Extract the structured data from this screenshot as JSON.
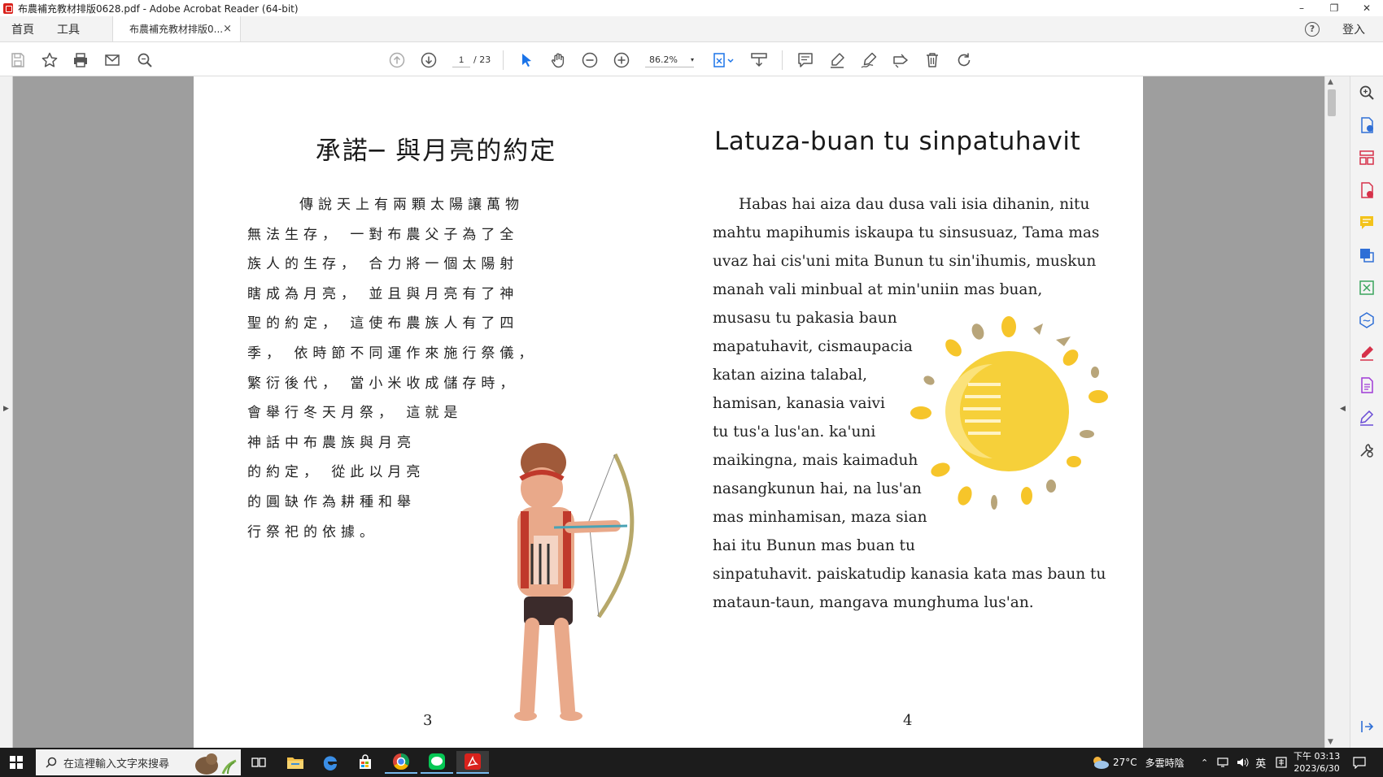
{
  "window": {
    "title": "布農補充教材排版0628.pdf - Adobe Acrobat Reader (64-bit)",
    "minimize": "–",
    "restore": "❐",
    "close": "✕"
  },
  "menu": {
    "home": "首頁",
    "tools": "工具",
    "doc_tab": "布農補充教材排版0...",
    "doc_tab_close": "×",
    "help": "?",
    "signin": "登入"
  },
  "toolbar": {
    "page_current": "1",
    "page_total": "/ 23",
    "zoom": "86.2%",
    "zoom_caret": "▾"
  },
  "page_left": {
    "title": "承諾─ 與月亮的約定",
    "lines": [
      "傳說天上有兩顆太陽讓萬物",
      "無法生存， 一對布農父子為了全",
      "族人的生存， 合力將一個太陽射",
      "瞎成為月亮， 並且與月亮有了神",
      "聖的約定， 這使布農族人有了四",
      "季， 依時節不同運作來施行祭儀，",
      "繁衍後代， 當小米收成儲存時，",
      "會舉行冬天月祭， 這就是",
      "神話中布農族與月亮",
      "的約定， 從此以月亮",
      "的圓缺作為耕種和舉",
      "行祭祀的依據。"
    ],
    "page_number": "3"
  },
  "page_right": {
    "title": "Latuza-buan tu sinpatuhavit",
    "lines": [
      "Habas hai aiza dau dusa vali isia dihanin, nitu",
      "mahtu mapihumis iskaupa tu sinsusuaz, Tama mas",
      "uvaz hai cis'uni mita Bunun tu sin'ihumis, muskun",
      "manah vali minbual at min'uniin mas buan,",
      "musasu tu pakasia baun",
      "mapatuhavit, cismaupacia",
      "katan aizina talabal,",
      "hamisan, kanasia vaivi",
      "tu tus'a lus'an. ka'uni",
      "maikingna, mais kaimaduh",
      "nasangkunun hai, na lus'an",
      "mas minhamisan, maza sian",
      "hai itu Bunun mas buan tu",
      "sinpatuhavit. paiskatudip kanasia kata mas baun tu",
      "mataun-taun, mangava munghuma lus'an."
    ],
    "page_number": "4"
  },
  "taskbar": {
    "search_placeholder": "在這裡輸入文字來搜尋",
    "weather_temp": "27°C",
    "weather_desc": "多雲時陰",
    "ime": "英",
    "time": "下午 03:13",
    "date": "2023/6/30"
  }
}
